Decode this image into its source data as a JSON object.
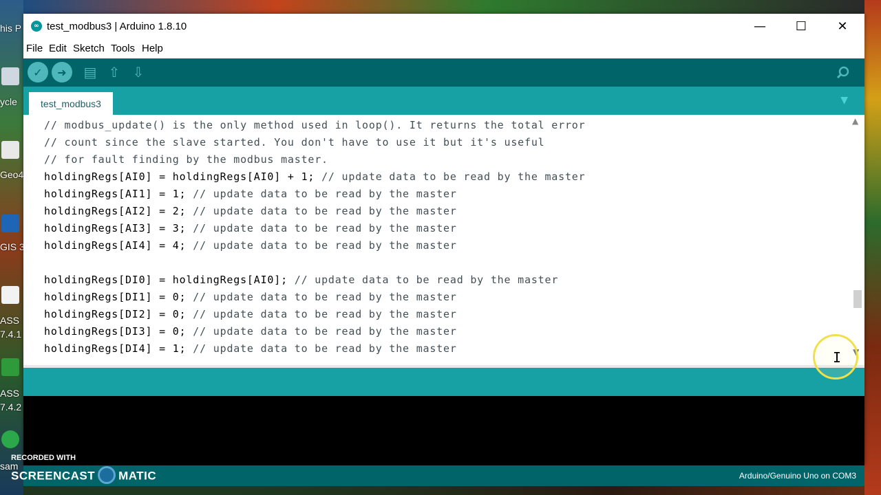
{
  "desktop": {
    "labels": [
      "his P",
      "ycle",
      "Geo4",
      "GIS 3",
      "ASS",
      "7.4.1",
      "ASS",
      "7.4.2",
      "sam"
    ]
  },
  "window": {
    "title": "test_modbus3 | Arduino 1.8.10",
    "controls": {
      "minimize": "—",
      "maximize": "☐",
      "close": "✕"
    }
  },
  "menu": {
    "items": [
      "File",
      "Edit",
      "Sketch",
      "Tools",
      "Help"
    ]
  },
  "toolbar": {
    "verify_icon": "check-icon",
    "upload_icon": "arrow-right-icon",
    "new_icon": "document-icon",
    "open_icon": "arrow-up-icon",
    "save_icon": "arrow-down-icon",
    "serial_monitor_icon": "magnifier-icon"
  },
  "tabs": {
    "active": "test_modbus3",
    "menu_glyph": "▼"
  },
  "editor": {
    "lines": [
      {
        "text": "// modbus_update() is the only method used in loop(). It returns the total error",
        "kind": "comment"
      },
      {
        "text": "// count since the slave started. You don't have to use it but it's useful",
        "kind": "comment"
      },
      {
        "text": "// for fault finding by the modbus master.",
        "kind": "comment"
      },
      {
        "code": "holdingRegs[AI0] = holdingRegs[AI0] + 1;",
        "comment": " // update data to be read by the master"
      },
      {
        "code": "holdingRegs[AI1] = 1;",
        "comment": " // update data to be read by the master"
      },
      {
        "code": "holdingRegs[AI2] = 2;",
        "comment": " // update data to be read by the master"
      },
      {
        "code": "holdingRegs[AI3] = 3;",
        "comment": " // update data to be read by the master"
      },
      {
        "code": "holdingRegs[AI4] = 4;",
        "comment": " // update data to be read by the master"
      },
      {
        "code": "",
        "comment": ""
      },
      {
        "code": "holdingRegs[DI0] = holdingRegs[AI0];",
        "comment": " // update data to be read by the master"
      },
      {
        "code": "holdingRegs[DI1] = 0;",
        "comment": " // update data to be read by the master"
      },
      {
        "code": "holdingRegs[DI2] = 0;",
        "comment": " // update data to be read by the master"
      },
      {
        "code": "holdingRegs[DI3] = 0;",
        "comment": " // update data to be read by the master"
      },
      {
        "code": "holdingRegs[DI4] = 1;",
        "comment": " // update data to be read by the master"
      }
    ]
  },
  "status": {
    "board": "Arduino/Genuino Uno on COM3"
  },
  "overlay": {
    "recorded_with": "RECORDED WITH",
    "brand_left": "SCREENCAST",
    "brand_right": "MATIC"
  },
  "colors": {
    "teal_dark": "#006468",
    "teal": "#17a1a5",
    "teal_light": "#4db7bb"
  }
}
